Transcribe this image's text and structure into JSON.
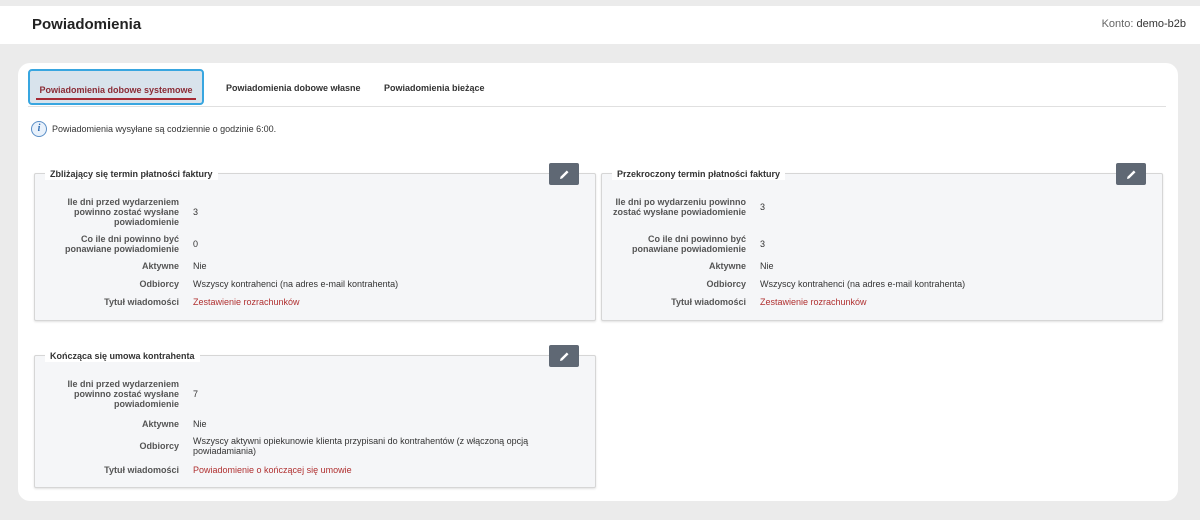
{
  "header": {
    "title": "Powiadomienia",
    "account_label": "Konto:",
    "account_name": "demo-b2b"
  },
  "tabs": [
    {
      "label": "Powiadomienia dobowe systemowe"
    },
    {
      "label": "Powiadomienia dobowe własne"
    },
    {
      "label": "Powiadomienia bieżące"
    }
  ],
  "info": {
    "text": "Powiadomienia wysyłane są codziennie o godzinie 6:00."
  },
  "panels": [
    {
      "title": "Zbliżający się termin płatności faktury",
      "fields": [
        {
          "label": "Ile dni przed wydarzeniem powinno zostać wysłane powiadomienie",
          "value": "3"
        },
        {
          "label": "Co ile dni powinno być ponawiane powiadomienie",
          "value": "0"
        },
        {
          "label": "Aktywne",
          "value": "Nie"
        },
        {
          "label": "Odbiorcy",
          "value": "Wszyscy kontrahenci (na adres e-mail kontrahenta)"
        },
        {
          "label": "Tytuł wiadomości",
          "value": "Zestawienie rozrachunków"
        }
      ]
    },
    {
      "title": "Przekroczony termin płatności faktury",
      "fields": [
        {
          "label": "Ile dni po wydarzeniu powinno zostać wysłane powiadomienie",
          "value": "3"
        },
        {
          "label": "Co ile dni powinno być ponawiane powiadomienie",
          "value": "3"
        },
        {
          "label": "Aktywne",
          "value": "Nie"
        },
        {
          "label": "Odbiorcy",
          "value": "Wszyscy kontrahenci (na adres e-mail kontrahenta)"
        },
        {
          "label": "Tytuł wiadomości",
          "value": "Zestawienie rozrachunków"
        }
      ]
    },
    {
      "title": "Kończąca się umowa kontrahenta",
      "fields": [
        {
          "label": "Ile dni przed wydarzeniem powinno zostać wysłane powiadomienie",
          "value": "7"
        },
        {
          "label": "Aktywne",
          "value": "Nie"
        },
        {
          "label": "Odbiorcy",
          "value": "Wszyscy aktywni opiekunowie klienta przypisani do kontrahentów (z włączoną opcją powiadamiania)"
        },
        {
          "label": "Tytuł wiadomości",
          "value": "Powiadomienie o kończącej się umowie"
        }
      ]
    }
  ],
  "icons": {
    "edit": "pencil-icon",
    "info": "info-icon"
  },
  "colors": {
    "accent_red": "#a52a35",
    "active_tab_border": "#38a6e0",
    "edit_button": "#5f6874"
  }
}
